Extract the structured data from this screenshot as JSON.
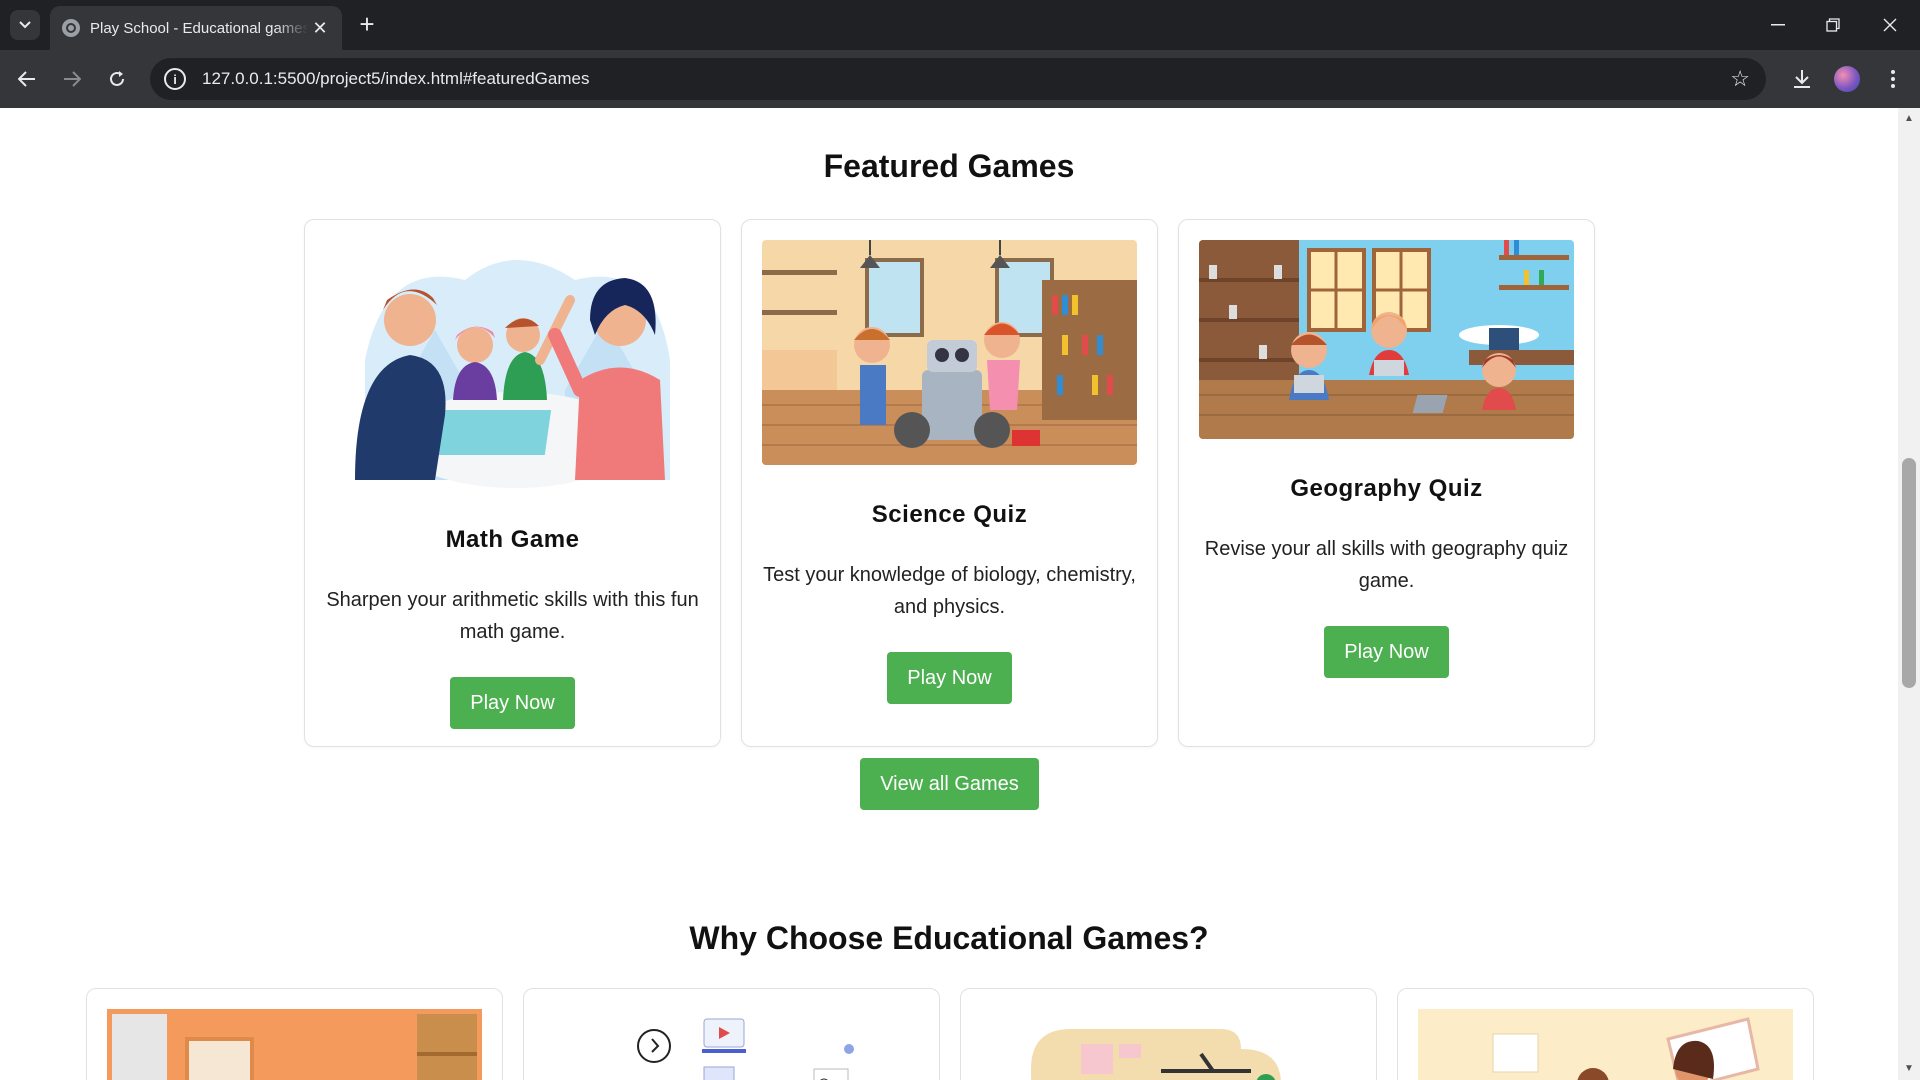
{
  "browser": {
    "tab_title": "Play School - Educational games",
    "url": "127.0.0.1:5500/project5/index.html#featuredGames",
    "icons": [
      "tab-search-icon",
      "globe-icon",
      "close-icon",
      "plus-icon",
      "minimize-icon",
      "restore-icon",
      "close-window-icon",
      "back-icon",
      "forward-icon",
      "reload-icon",
      "info-icon",
      "star-icon",
      "download-icon",
      "menu-icon"
    ]
  },
  "featured": {
    "title": "Featured Games",
    "cards": [
      {
        "title": "Math Game",
        "description": "Sharpen your arithmetic skills with this fun math game.",
        "button": "Play Now"
      },
      {
        "title": "Science Quiz",
        "description": "Test your knowledge of biology, chemistry, and physics.",
        "button": "Play Now"
      },
      {
        "title": "Geography Quiz",
        "description": "Revise your all skills with geography quiz game.",
        "button": "Play Now"
      }
    ],
    "view_all": "View all Games"
  },
  "why": {
    "title": "Why Choose Educational Games?"
  },
  "colors": {
    "accent_green": "#4caf50",
    "chrome_dark": "#202124",
    "chrome_mid": "#35363a"
  }
}
